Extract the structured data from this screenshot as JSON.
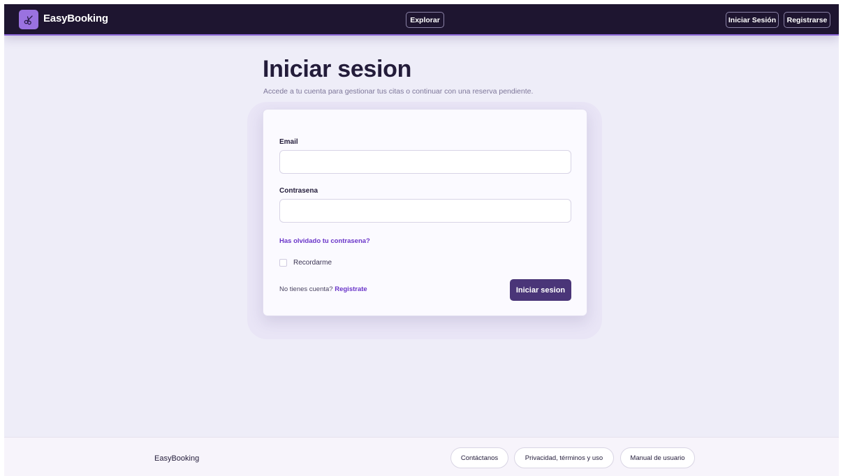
{
  "nav": {
    "brand": "EasyBooking",
    "explore_label": "Explorar",
    "login_label": "Iniciar Sesión",
    "register_label": "Registrarse"
  },
  "main": {
    "title": "Iniciar sesion",
    "subtitle": "Accede a tu cuenta para gestionar tus citas o continuar con una reserva pendiente."
  },
  "form": {
    "email_label": "Email",
    "email_value": "",
    "password_label": "Contrasena",
    "password_value": "",
    "forgot_label": "Has olvidado tu contrasena?",
    "remember_label": "Recordarme",
    "remember_checked": false,
    "no_account_text": "No tienes cuenta?",
    "register_link": "Registrate",
    "submit_label": "Iniciar sesion"
  },
  "footer": {
    "brand": "EasyBooking",
    "links": [
      "Contáctanos",
      "Privacidad, términos y uso",
      "Manual de usuario"
    ]
  },
  "colors": {
    "nav_bg": "#1e1530",
    "accent": "#9a72e0",
    "link": "#6a35c9",
    "primary_button": "#4a3578",
    "page_bg": "#eeedf8"
  },
  "icons": {
    "logo": "scissors-icon"
  }
}
